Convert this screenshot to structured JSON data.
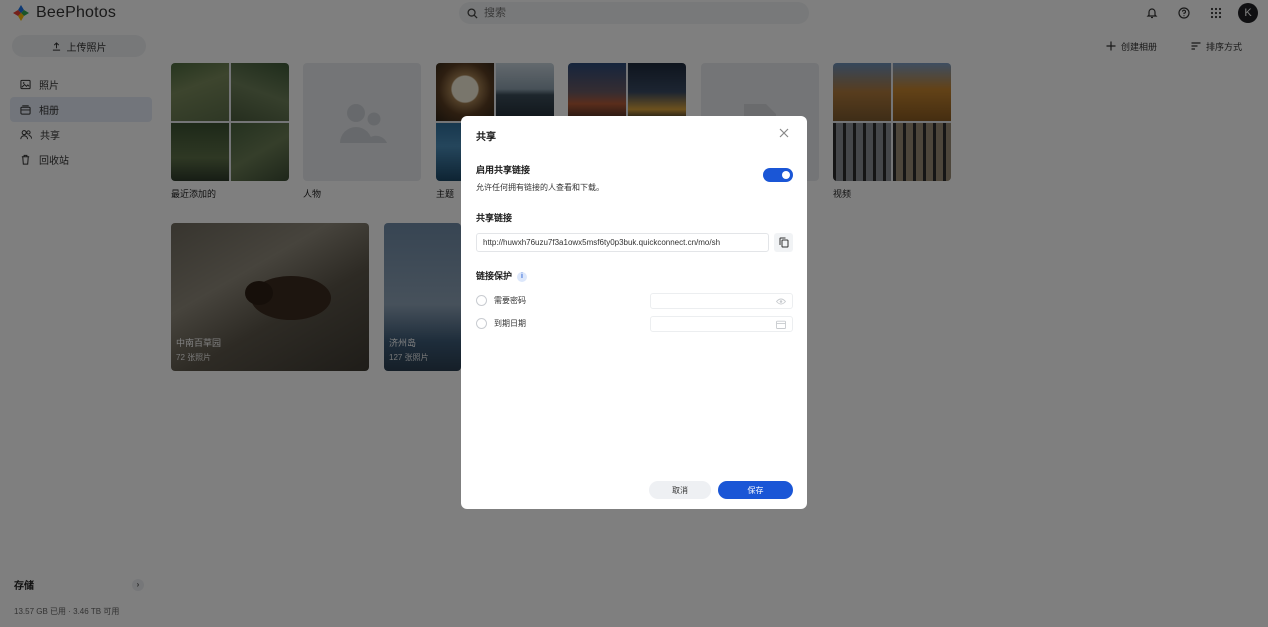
{
  "app": {
    "name": "BeePhotos"
  },
  "search": {
    "placeholder": "搜索"
  },
  "user": {
    "initial": "K"
  },
  "sidebar": {
    "upload_label": "上传照片",
    "items": [
      {
        "label": "照片"
      },
      {
        "label": "相册"
      },
      {
        "label": "共享"
      },
      {
        "label": "回收站"
      }
    ],
    "storage": {
      "title": "存储",
      "usage": "13.57 GB 已用 · 3.46 TB 可用"
    }
  },
  "toolbar": {
    "create_album": "创建相册",
    "sort": "排序方式"
  },
  "albums": [
    {
      "label": "最近添加的"
    },
    {
      "label": "人物"
    },
    {
      "label": "主题"
    },
    {
      "label": ""
    },
    {
      "label": ""
    },
    {
      "label": "视频"
    }
  ],
  "big_albums": [
    {
      "title": "中南百草园",
      "count": "72 张照片"
    },
    {
      "title": "济州岛",
      "count": "127 张照片"
    }
  ],
  "modal": {
    "title": "共享",
    "enable_title": "启用共享链接",
    "enable_desc": "允许任何拥有链接的人查看和下载。",
    "link_title": "共享链接",
    "link_value": "http://huwxh76uzu7f3a1owx5msf6ty0p3buk.quickconnect.cn/mo/sh",
    "protection_title": "链接保护",
    "info_mark": "i",
    "options": [
      {
        "label": "需要密码"
      },
      {
        "label": "到期日期"
      }
    ],
    "cancel": "取消",
    "save": "保存",
    "toggle_on": true
  },
  "colors": {
    "accent": "#1a56d6",
    "active_nav": "#e4ebf6"
  }
}
